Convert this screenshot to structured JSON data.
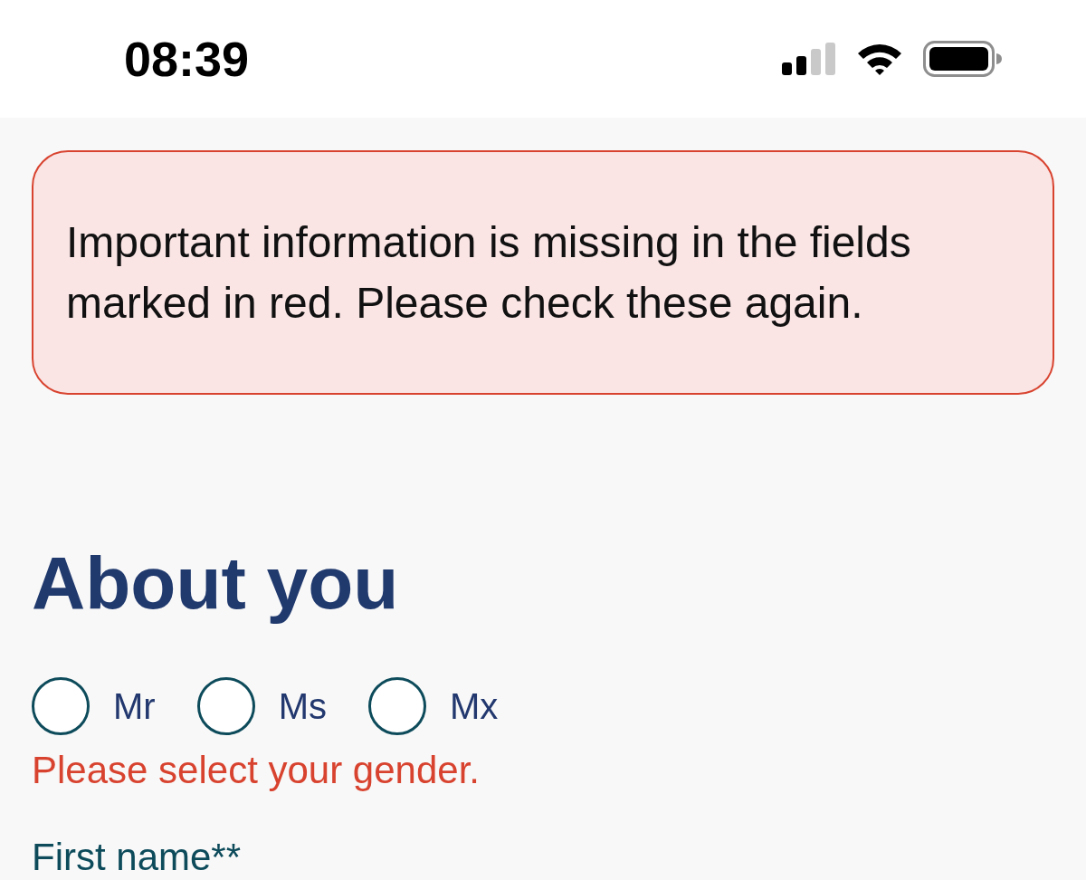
{
  "status_bar": {
    "time": "08:39"
  },
  "alert": {
    "message": "Important information is missing in the fields marked in red. Please check these again."
  },
  "section": {
    "title": "About you"
  },
  "gender": {
    "options": [
      {
        "label": "Mr",
        "selected": false
      },
      {
        "label": "Ms",
        "selected": false
      },
      {
        "label": "Mx",
        "selected": false
      }
    ],
    "error": "Please select your gender."
  },
  "fields": [
    {
      "label": "First name**"
    }
  ]
}
